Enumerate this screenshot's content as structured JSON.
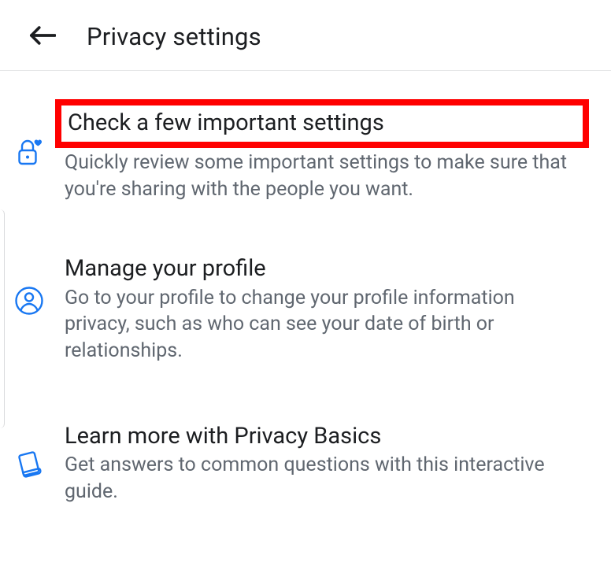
{
  "colors": {
    "icon_blue": "#1877f2",
    "text_primary": "#1c1e21",
    "text_secondary": "#606770",
    "highlight": "#ff0000"
  },
  "header": {
    "title": "Privacy settings",
    "back_icon": "arrow-left"
  },
  "items": [
    {
      "icon": "lock-heart",
      "title": "Check a few important settings",
      "desc": "Quickly review some important settings to make sure that you're sharing with the people you want.",
      "highlighted": true
    },
    {
      "icon": "person-circle",
      "title": "Manage your profile",
      "desc": "Go to your profile to change your profile information privacy, such as who can see your date of birth or relationships."
    },
    {
      "icon": "book",
      "title": "Learn more with Privacy Basics",
      "desc": "Get answers to common questions with this interactive guide."
    }
  ]
}
